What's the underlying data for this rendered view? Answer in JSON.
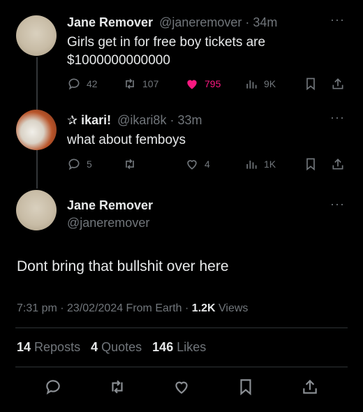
{
  "tweet1": {
    "name": "Jane Remover",
    "meta": "@janeremover · 34m",
    "text_line1": "Girls get in for free boy tickets are",
    "text_line2": "$1000000000000",
    "replies": "42",
    "reposts": "107",
    "likes": "795",
    "views": "9K",
    "like_color": "#f91880"
  },
  "tweet2": {
    "name": "ikari!",
    "meta": "@ikari8k · 33m",
    "text": "what about femboys",
    "replies": "5",
    "likes": "4",
    "views": "1K"
  },
  "main": {
    "name": "Jane Remover",
    "handle": "@janeremover",
    "text": "Dont bring that bullshit over here",
    "time": "7:31 pm · 23/02/2024 From Earth · ",
    "views_count": "1.2K",
    "views_label": " Views",
    "reposts_count": "14",
    "reposts_label": " Reposts",
    "quotes_count": "4",
    "quotes_label": " Quotes",
    "likes_count": "146",
    "likes_label": " Likes"
  },
  "icons": [
    "reply-icon",
    "repost-icon",
    "heart-icon",
    "views-icon",
    "bookmark-icon",
    "share-icon",
    "more-icon"
  ]
}
